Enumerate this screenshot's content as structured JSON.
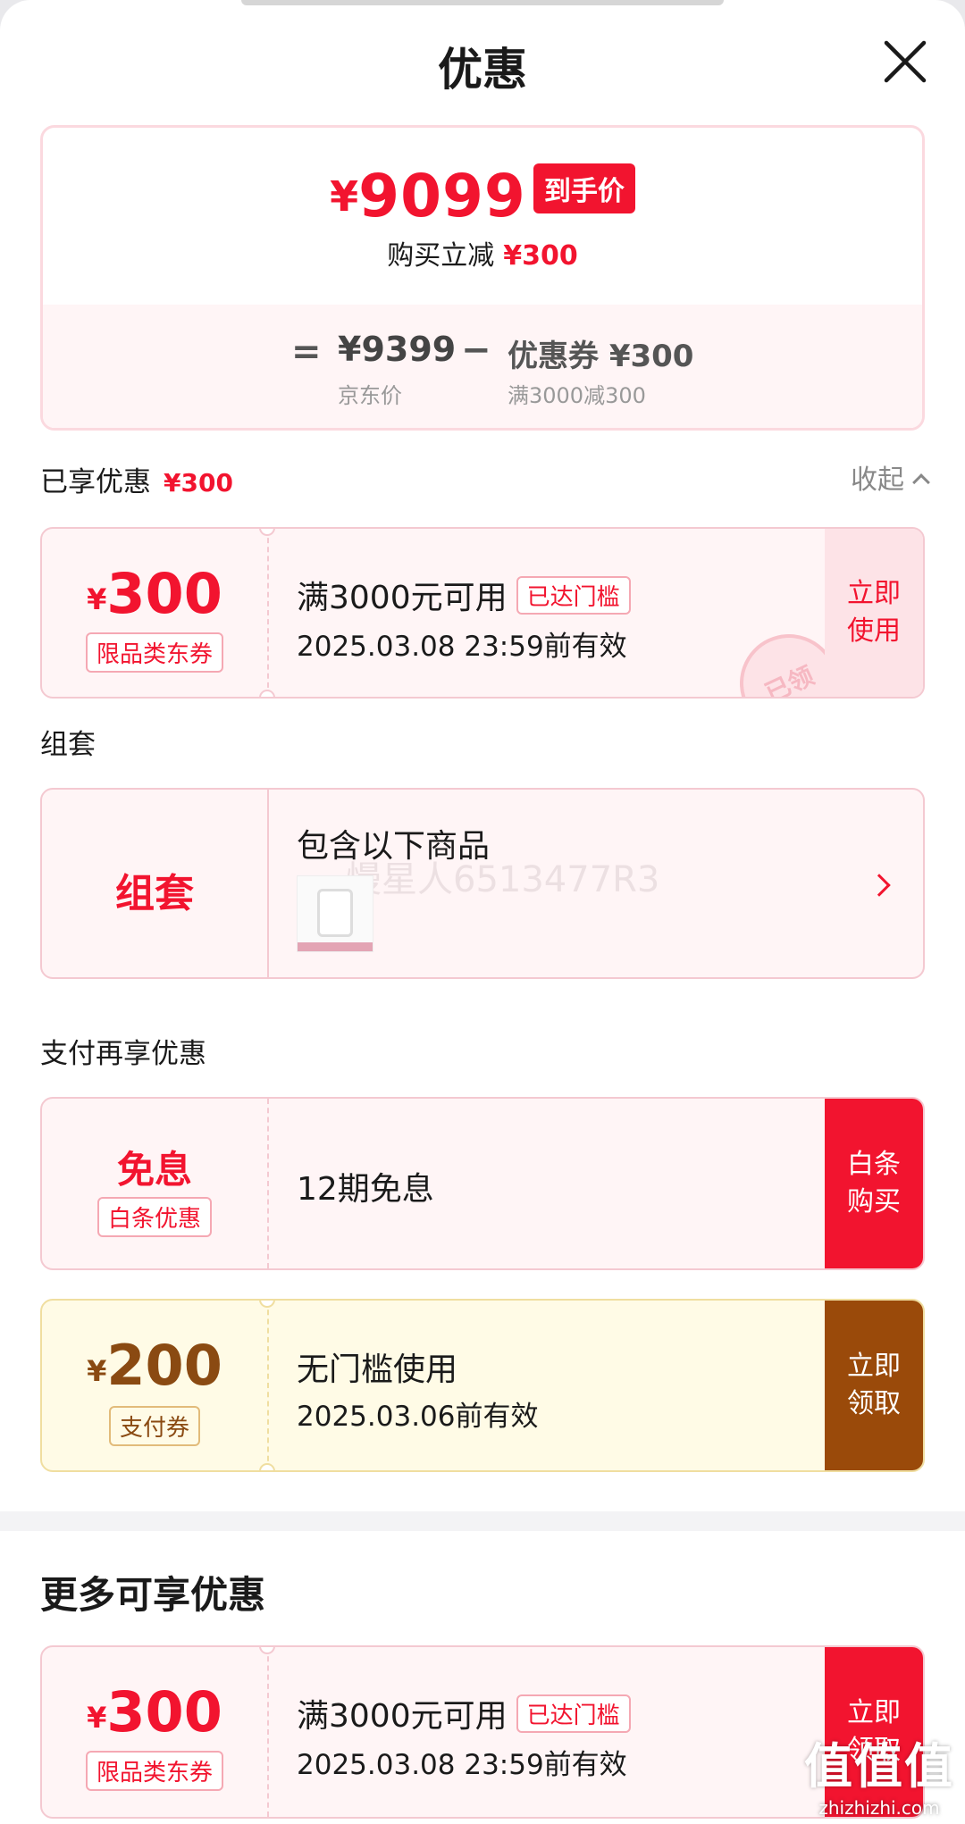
{
  "header": {
    "title": "优惠"
  },
  "summary": {
    "currency": "¥",
    "final_price": "9099",
    "final_badge": "到手价",
    "saved_label": "购买立减",
    "saved_amount": "¥300",
    "equals": "=",
    "base_price": "¥9399",
    "base_label": "京东价",
    "minus": "−",
    "coupon_value": "优惠券 ¥300",
    "coupon_rule": "满3000减300"
  },
  "enjoyed": {
    "label": "已享优惠",
    "amount": "¥300",
    "collapse_label": "收起"
  },
  "enjoyed_coupon": {
    "currency": "¥",
    "amount": "300",
    "type_tag": "限品类东券",
    "condition": "满3000元可用",
    "reached_tag": "已达门槛",
    "expiry": "2025.03.08 23:59前有效",
    "action": "立即\n使用",
    "stamp": "已领"
  },
  "bundle_section": {
    "label": "组套"
  },
  "bundle": {
    "left_label": "组套",
    "title": "包含以下商品",
    "watermark": "慢星人6513477R3"
  },
  "pay_section": {
    "label": "支付再享优惠"
  },
  "baitiao": {
    "left_label": "免息",
    "type_tag": "白条优惠",
    "description": "12期免息",
    "action": "白条\n购买"
  },
  "pay_coupon": {
    "currency": "¥",
    "amount": "200",
    "type_tag": "支付券",
    "condition": "无门槛使用",
    "expiry": "2025.03.06前有效",
    "action": "立即\n领取"
  },
  "more_section": {
    "label": "更多可享优惠"
  },
  "more_coupon": {
    "currency": "¥",
    "amount": "300",
    "type_tag": "限品类东券",
    "condition": "满3000元可用",
    "reached_tag": "已达门槛",
    "expiry": "2025.03.08 23:59前有效",
    "action": "立即\n领取"
  },
  "site_watermark": {
    "logo": "值值值",
    "url": "zhizhizhi.com"
  },
  "colors": {
    "accent_red": "#f2142f",
    "card_pink_bg": "#fff5f6",
    "card_yellow_bg": "#fffbe6",
    "brown_button": "#9a4a0a",
    "brown_text": "#8a4a12"
  }
}
